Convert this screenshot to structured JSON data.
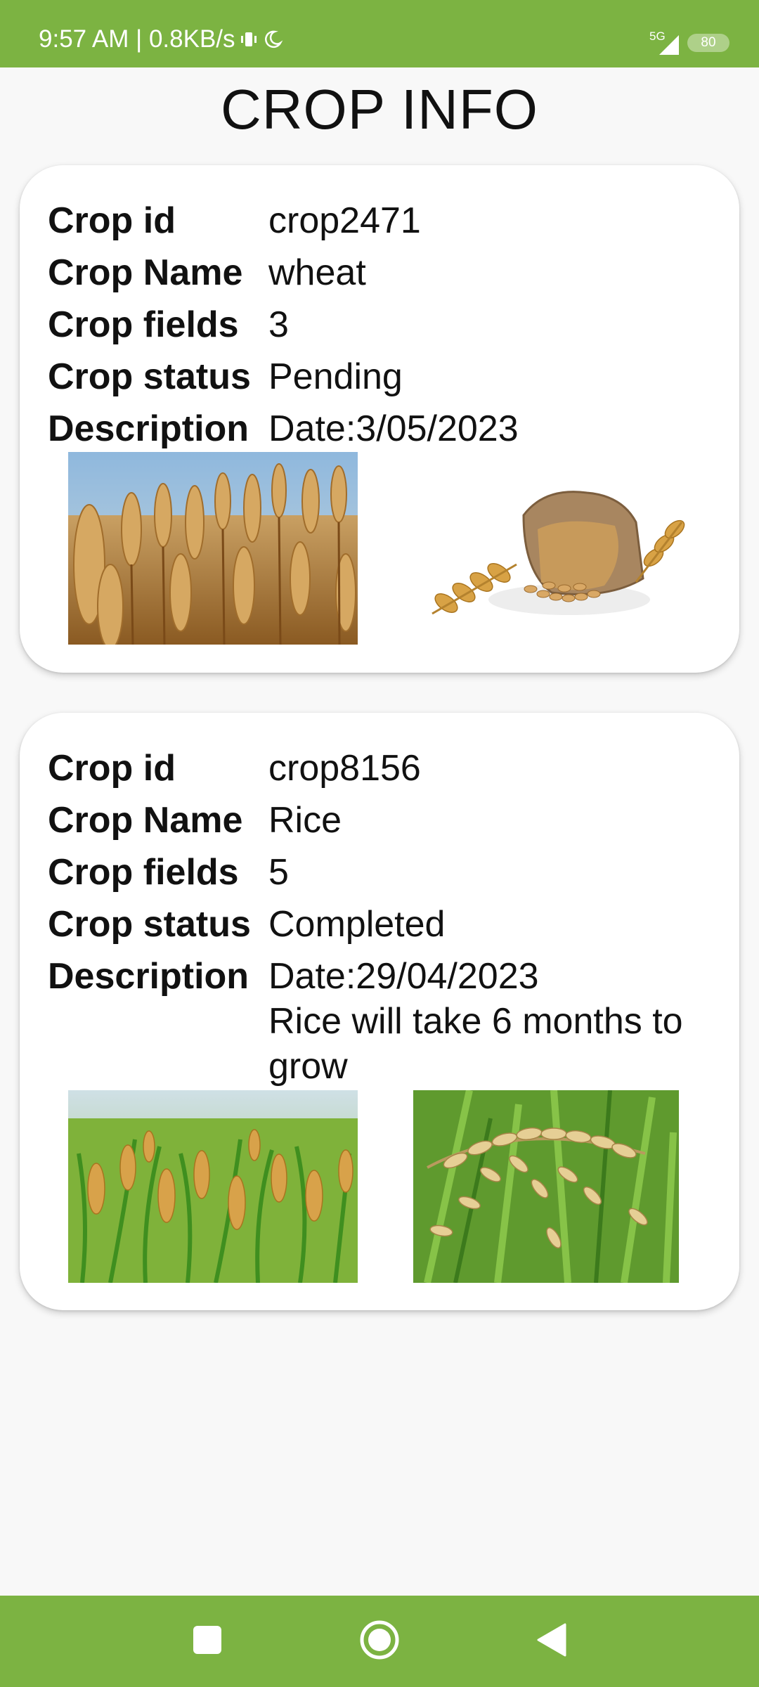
{
  "status_bar": {
    "time_speed": "9:57 AM | 0.8KB/s",
    "network": "5G",
    "battery": "80",
    "icons": [
      "vibrate-icon",
      "moon-icon",
      "signal-icon",
      "battery-icon"
    ]
  },
  "header": {
    "title": "CROP INFO"
  },
  "labels": {
    "crop_id": "Crop id",
    "crop_name": "Crop Name",
    "crop_fields": "Crop fields",
    "crop_status": "Crop status",
    "description": "Description"
  },
  "crops": [
    {
      "id": "crop2471",
      "name": "wheat",
      "fields": "3",
      "status": "Pending",
      "description_lines": [
        "Date:3/05/2023"
      ],
      "images": [
        "wheat-field-photo",
        "wheat-grain-sack-photo"
      ]
    },
    {
      "id": "crop8156",
      "name": "Rice",
      "fields": "5",
      "status": "Completed",
      "description_lines": [
        "Date:29/04/2023",
        "Rice will take 6 months to",
        "grow"
      ],
      "images": [
        "rice-field-photo",
        "rice-grains-closeup-photo"
      ]
    }
  ],
  "nav_bar": {
    "buttons": [
      "recent-apps-icon",
      "home-icon",
      "back-icon"
    ]
  },
  "colors": {
    "accent": "#7cb342",
    "background": "#f8f8f8",
    "card": "#ffffff",
    "text": "#111111"
  }
}
